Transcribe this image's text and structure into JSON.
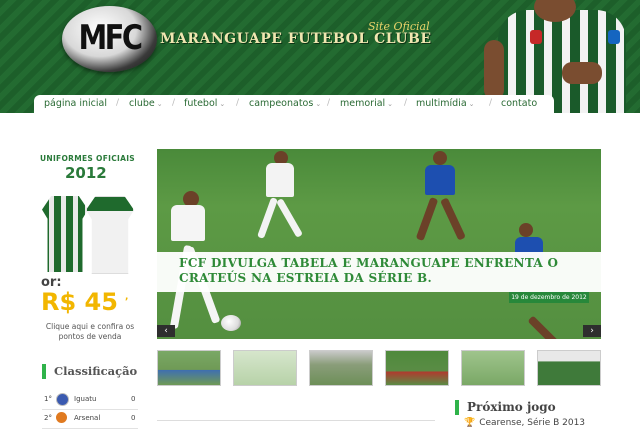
{
  "header": {
    "logo_text": "MFC",
    "site_oficial": "Site Oficial",
    "club_name": "MARANGUAPE FUTEBOL CLUBE",
    "colors": {
      "green_dark": "#1d5f2a",
      "gold": "#e9d36a",
      "accent_green": "#2fb34a"
    }
  },
  "nav": {
    "items": [
      {
        "label": "página inicial",
        "has_dropdown": false
      },
      {
        "label": "clube",
        "has_dropdown": true
      },
      {
        "label": "futebol",
        "has_dropdown": true
      },
      {
        "label": "campeonatos",
        "has_dropdown": true
      },
      {
        "label": "memorial",
        "has_dropdown": true
      },
      {
        "label": "multimídia",
        "has_dropdown": true
      },
      {
        "label": "contato",
        "has_dropdown": false
      }
    ],
    "separator": "/",
    "chevron": "⌄"
  },
  "sidebar": {
    "uniformes_title": "UNIFORMES OFICIAIS",
    "uniformes_year": "2012",
    "or_label": "or:",
    "price": "R$ 45",
    "price_cents": ",",
    "clique_text": "Clique aqui e confira os pontos de venda",
    "classificacao_title": "Classificação",
    "classificacao": [
      {
        "pos": "1°",
        "team": "Iguatu",
        "pts": "0",
        "crest_color": "#3a5ab0"
      },
      {
        "pos": "2°",
        "team": "Arsenal",
        "pts": "0",
        "crest_color": "#e07a20"
      }
    ]
  },
  "slider": {
    "headline": "FCF DIVULGA TABELA E MARANGUAPE ENFRENTA O CRATEÚS NA ESTREIA DA SÉRIE B.",
    "date": "19 de dezembro de 2012",
    "prev_icon": "‹",
    "next_icon": "›"
  },
  "thumbnails": [
    {
      "name": "thumb-1",
      "color": "#6f9a55"
    },
    {
      "name": "thumb-2",
      "color": "#b7d2a8"
    },
    {
      "name": "thumb-3",
      "color": "#8a9d7a"
    },
    {
      "name": "thumb-4",
      "color": "#5a8c45"
    },
    {
      "name": "thumb-5",
      "color": "#7aa866"
    },
    {
      "name": "thumb-6",
      "color": "#3f7a3a"
    }
  ],
  "proximo_jogo": {
    "title": "Próximo jogo",
    "competition": "Cearense, Série B 2013"
  }
}
